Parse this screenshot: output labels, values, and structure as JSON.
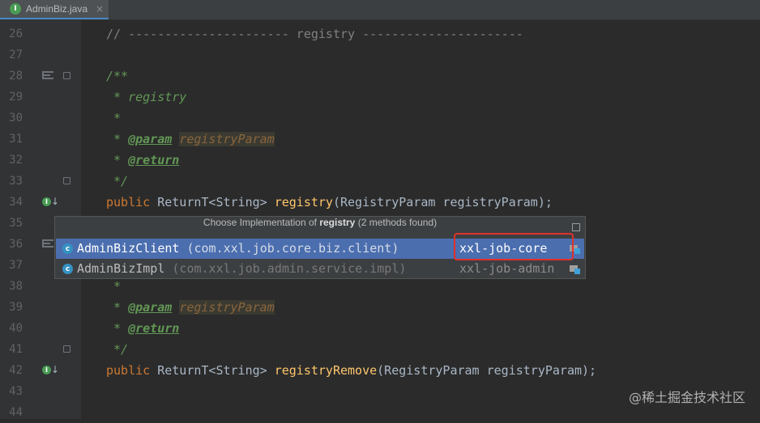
{
  "tab": {
    "icon": "interface-icon",
    "icon_letter": "I",
    "label": "AdminBiz.java",
    "close": "×"
  },
  "lines": [
    {
      "num": "26",
      "tokens": [
        {
          "t": "// ---------------------- registry ----------------------",
          "c": "c-comment"
        }
      ]
    },
    {
      "num": "27",
      "tokens": []
    },
    {
      "num": "28",
      "tokens": [
        {
          "t": "/**",
          "c": "c-doc"
        }
      ]
    },
    {
      "num": "29",
      "tokens": [
        {
          "t": " * registry",
          "c": "c-doc"
        }
      ]
    },
    {
      "num": "30",
      "tokens": [
        {
          "t": " *",
          "c": "c-doc"
        }
      ]
    },
    {
      "num": "31",
      "tokens": [
        {
          "t": " * ",
          "c": "c-doc"
        },
        {
          "t": "@param",
          "c": "c-tag"
        },
        {
          "t": " ",
          "c": "c-doc"
        },
        {
          "t": "registryParam",
          "c": "c-param"
        }
      ]
    },
    {
      "num": "32",
      "tokens": [
        {
          "t": " * ",
          "c": "c-doc"
        },
        {
          "t": "@return",
          "c": "c-tag"
        }
      ]
    },
    {
      "num": "33",
      "tokens": [
        {
          "t": " */",
          "c": "c-doc"
        }
      ]
    },
    {
      "num": "34",
      "tokens": [
        {
          "t": "public ",
          "c": "c-kw"
        },
        {
          "t": "ReturnT<String> ",
          "c": ""
        },
        {
          "t": "registry",
          "c": "c-fn"
        },
        {
          "t": "(RegistryParam registryParam);",
          "c": ""
        }
      ]
    },
    {
      "num": "35",
      "tokens": []
    },
    {
      "num": "36",
      "tokens": []
    },
    {
      "num": "37",
      "tokens": []
    },
    {
      "num": "38",
      "tokens": [
        {
          "t": " *",
          "c": "c-doc"
        }
      ]
    },
    {
      "num": "39",
      "tokens": [
        {
          "t": " * ",
          "c": "c-doc"
        },
        {
          "t": "@param",
          "c": "c-tag"
        },
        {
          "t": " ",
          "c": "c-doc"
        },
        {
          "t": "registryParam",
          "c": "c-param"
        }
      ]
    },
    {
      "num": "40",
      "tokens": [
        {
          "t": " * ",
          "c": "c-doc"
        },
        {
          "t": "@return",
          "c": "c-tag"
        }
      ]
    },
    {
      "num": "41",
      "tokens": [
        {
          "t": " */",
          "c": "c-doc"
        }
      ]
    },
    {
      "num": "42",
      "tokens": [
        {
          "t": "public ",
          "c": "c-kw"
        },
        {
          "t": "ReturnT<String> ",
          "c": ""
        },
        {
          "t": "registryRemove",
          "c": "c-fn"
        },
        {
          "t": "(RegistryParam registryParam);",
          "c": ""
        }
      ]
    },
    {
      "num": "43",
      "tokens": []
    },
    {
      "num": "44",
      "tokens": []
    }
  ],
  "gutter_icons": {
    "doc_marker_lines": [
      "28",
      "36"
    ],
    "fold_lines": [
      "28",
      "33",
      "41"
    ],
    "implemented_lines": [
      "34",
      "42"
    ]
  },
  "popup": {
    "title_prefix": "Choose Implementation of ",
    "title_method": "registry",
    "title_suffix": " (2 methods found)",
    "items": [
      {
        "icon": "class-icon",
        "icon_letter": "c",
        "name": "AdminBizClient",
        "package": " (com.xxl.job.core.biz.client)",
        "module": "xxl-job-core",
        "selected": true
      },
      {
        "icon": "class-icon",
        "icon_letter": "c",
        "name": "AdminBizImpl",
        "package": " (com.xxl.job.admin.service.impl)",
        "module": "xxl-job-admin",
        "selected": false
      }
    ]
  },
  "watermark": "@稀土掘金技术社区",
  "colors": {
    "background": "#2b2b2b",
    "selection": "#4b6eaf",
    "highlight_box": "#e0302a"
  }
}
